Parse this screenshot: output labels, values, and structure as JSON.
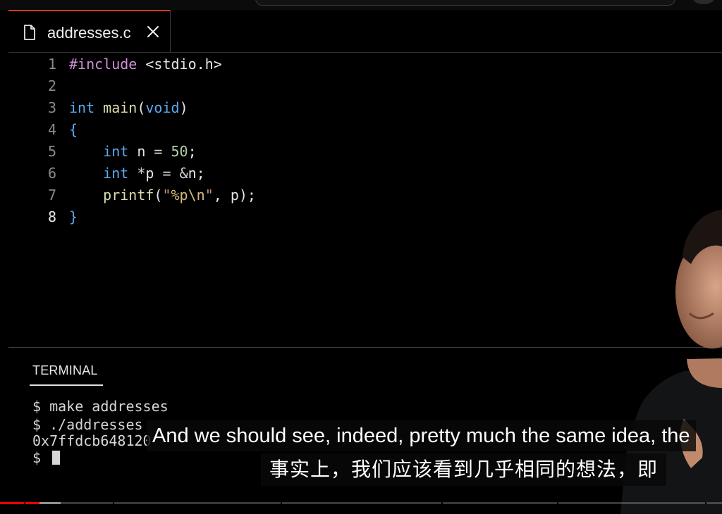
{
  "editor": {
    "tab": {
      "filename": "addresses.c",
      "icon": "file-icon",
      "close_icon": "close-icon"
    },
    "lines": [
      {
        "number": "1",
        "tokens": [
          {
            "t": "#include",
            "c": "kw-pre"
          },
          {
            "t": " <stdio.h>",
            "c": "inc"
          }
        ]
      },
      {
        "number": "2",
        "tokens": []
      },
      {
        "number": "3",
        "tokens": [
          {
            "t": "int",
            "c": "kw"
          },
          {
            "t": " ",
            "c": "plain"
          },
          {
            "t": "main",
            "c": "fn"
          },
          {
            "t": "(",
            "c": "plain"
          },
          {
            "t": "void",
            "c": "kw"
          },
          {
            "t": ")",
            "c": "plain"
          }
        ]
      },
      {
        "number": "4",
        "tokens": [
          {
            "t": "{",
            "c": "brace"
          }
        ]
      },
      {
        "number": "5",
        "tokens": [
          {
            "t": "    ",
            "c": "plain"
          },
          {
            "t": "int",
            "c": "kw"
          },
          {
            "t": " n ",
            "c": "plain"
          },
          {
            "t": "=",
            "c": "op"
          },
          {
            "t": " ",
            "c": "plain"
          },
          {
            "t": "50",
            "c": "num"
          },
          {
            "t": ";",
            "c": "plain"
          }
        ]
      },
      {
        "number": "6",
        "tokens": [
          {
            "t": "    ",
            "c": "plain"
          },
          {
            "t": "int",
            "c": "kw"
          },
          {
            "t": " ",
            "c": "plain"
          },
          {
            "t": "*",
            "c": "op"
          },
          {
            "t": "p ",
            "c": "plain"
          },
          {
            "t": "=",
            "c": "op"
          },
          {
            "t": " ",
            "c": "plain"
          },
          {
            "t": "&",
            "c": "op"
          },
          {
            "t": "n;",
            "c": "plain"
          }
        ]
      },
      {
        "number": "7",
        "tokens": [
          {
            "t": "    ",
            "c": "plain"
          },
          {
            "t": "printf",
            "c": "fn"
          },
          {
            "t": "(",
            "c": "plain"
          },
          {
            "t": "\"",
            "c": "str"
          },
          {
            "t": "%p\\n",
            "c": "esc"
          },
          {
            "t": "\"",
            "c": "str"
          },
          {
            "t": ", p);",
            "c": "plain"
          }
        ]
      },
      {
        "number": "8",
        "tokens": [
          {
            "t": "}",
            "c": "brace"
          }
        ],
        "active": true
      }
    ]
  },
  "terminal": {
    "header": "TERMINAL",
    "lines": [
      "$ make addresses",
      "$ ./addresses",
      "0x7ffdcb648120",
      "$ "
    ]
  },
  "subtitles": {
    "english": "And we should see, indeed, pretty much the same idea, the",
    "chinese": "事实上，我们应该看到几乎相同的想法，即"
  },
  "player": {
    "progress_fraction": 0.055,
    "buffered_fraction": 0.084
  },
  "colors": {
    "accent_tab": "#d23a2d",
    "progress": "#ff0000"
  }
}
